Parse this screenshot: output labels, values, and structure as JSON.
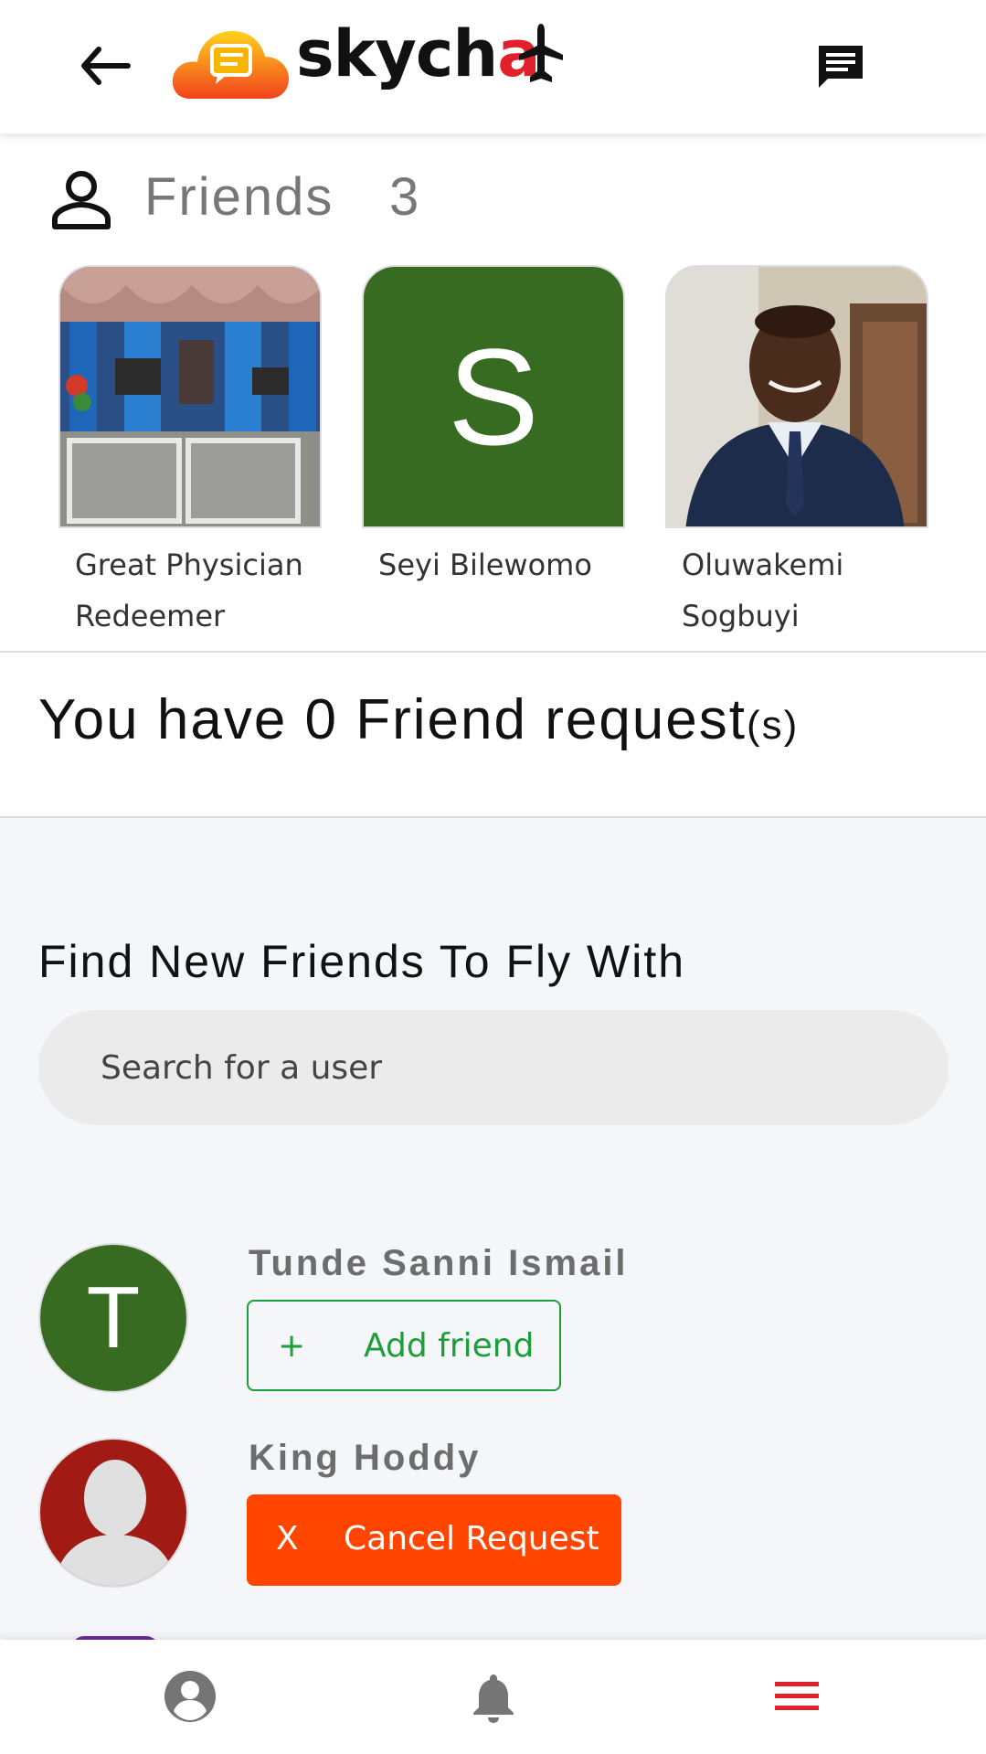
{
  "header": {
    "back_icon": "arrow-left-icon",
    "logo_text_main": "skych",
    "logo_text_accent": "a",
    "chat_icon": "chat-message-icon",
    "colors": {
      "logo_red": "#e0202a",
      "logo_cloud_top": "#ffd21c",
      "logo_cloud_bottom": "#f2411c"
    }
  },
  "friends": {
    "icon": "person-outline-icon",
    "label": "Friends",
    "count": "3",
    "items": [
      {
        "name_line1": "Great Physician",
        "name_line2": "Redeemer",
        "photo": "church-interior-photo"
      },
      {
        "name_line1": "Seyi Bilewomo",
        "name_line2": "",
        "initial": "S",
        "color": "#366b21"
      },
      {
        "name_line1": "Oluwakemi",
        "name_line2": "Sogbuyi",
        "photo": "man-in-suit-photo"
      }
    ]
  },
  "requests": {
    "text_main": "You have 0 Friend request",
    "text_suffix": "(s)"
  },
  "find": {
    "title": "Find New Friends To Fly With",
    "search_placeholder": "Search for a user",
    "users": [
      {
        "name": "Tunde Sanni Ismail",
        "initial": "T",
        "avatar_color": "#366b21",
        "action_symbol": "+",
        "action_label": "Add friend",
        "action_color": "#1e9e3a"
      },
      {
        "name": "King Hoddy",
        "avatar": "default-user-silhouette",
        "action_symbol": "X",
        "action_label": "Cancel Request",
        "action_color": "#ff4500"
      }
    ]
  },
  "bottom_nav": {
    "items": [
      {
        "icon": "account-circle-icon"
      },
      {
        "icon": "bell-icon"
      },
      {
        "icon": "menu-icon",
        "color": "#e0202a"
      }
    ]
  }
}
